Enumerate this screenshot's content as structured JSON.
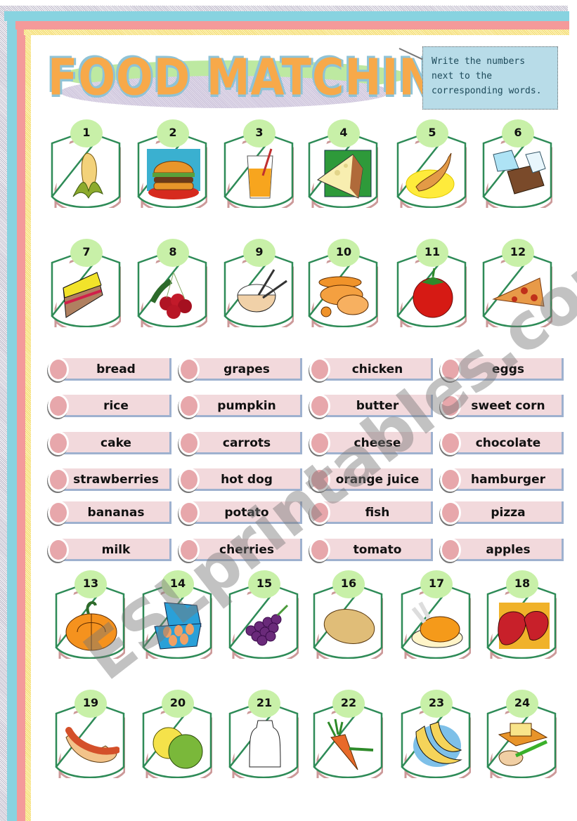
{
  "worksheet": {
    "title": "FOOD MATCHING",
    "instructions": "Write the numbers next to the corresponding words.",
    "watermark": "ESLprintables.com"
  },
  "colors": {
    "title_fill": "#f7a94a",
    "title_outline": "#8fc3d6",
    "number_badge": "#c8f0a8",
    "card_border": "#2e8b57",
    "word_box": "#f2d9dc",
    "word_circle": "#e7a7ab",
    "instructions_bg": "#b8dce8",
    "stripe_blue": "#88d3e0",
    "stripe_pink": "#f49a9a",
    "stripe_yellow": "#f2d86a"
  },
  "pictures": [
    {
      "number": "1",
      "icon": "corn-icon"
    },
    {
      "number": "2",
      "icon": "hamburger-icon"
    },
    {
      "number": "3",
      "icon": "orange-juice-icon"
    },
    {
      "number": "4",
      "icon": "cheese-icon"
    },
    {
      "number": "5",
      "icon": "fish-icon"
    },
    {
      "number": "6",
      "icon": "chocolate-icon"
    },
    {
      "number": "7",
      "icon": "cake-icon"
    },
    {
      "number": "8",
      "icon": "cherries-icon"
    },
    {
      "number": "9",
      "icon": "rice-icon"
    },
    {
      "number": "10",
      "icon": "bread-icon"
    },
    {
      "number": "11",
      "icon": "tomato-icon"
    },
    {
      "number": "12",
      "icon": "pizza-icon"
    },
    {
      "number": "13",
      "icon": "pumpkin-icon"
    },
    {
      "number": "14",
      "icon": "eggs-icon"
    },
    {
      "number": "15",
      "icon": "grapes-icon"
    },
    {
      "number": "16",
      "icon": "potato-icon"
    },
    {
      "number": "17",
      "icon": "chicken-icon"
    },
    {
      "number": "18",
      "icon": "strawberries-icon"
    },
    {
      "number": "19",
      "icon": "hot-dog-icon"
    },
    {
      "number": "20",
      "icon": "apples-icon"
    },
    {
      "number": "21",
      "icon": "milk-icon"
    },
    {
      "number": "22",
      "icon": "carrots-icon"
    },
    {
      "number": "23",
      "icon": "bananas-icon"
    },
    {
      "number": "24",
      "icon": "butter-icon"
    }
  ],
  "words": [
    [
      "bread",
      "grapes",
      "chicken",
      "eggs"
    ],
    [
      "rice",
      "pumpkin",
      "butter",
      "sweet corn"
    ],
    [
      "cake",
      "carrots",
      "cheese",
      "chocolate"
    ],
    [
      "strawberries",
      "hot dog",
      "orange juice",
      "hamburger"
    ],
    [
      "bananas",
      "potato",
      "fish",
      "pizza"
    ],
    [
      "milk",
      "cherries",
      "tomato",
      "apples"
    ]
  ]
}
